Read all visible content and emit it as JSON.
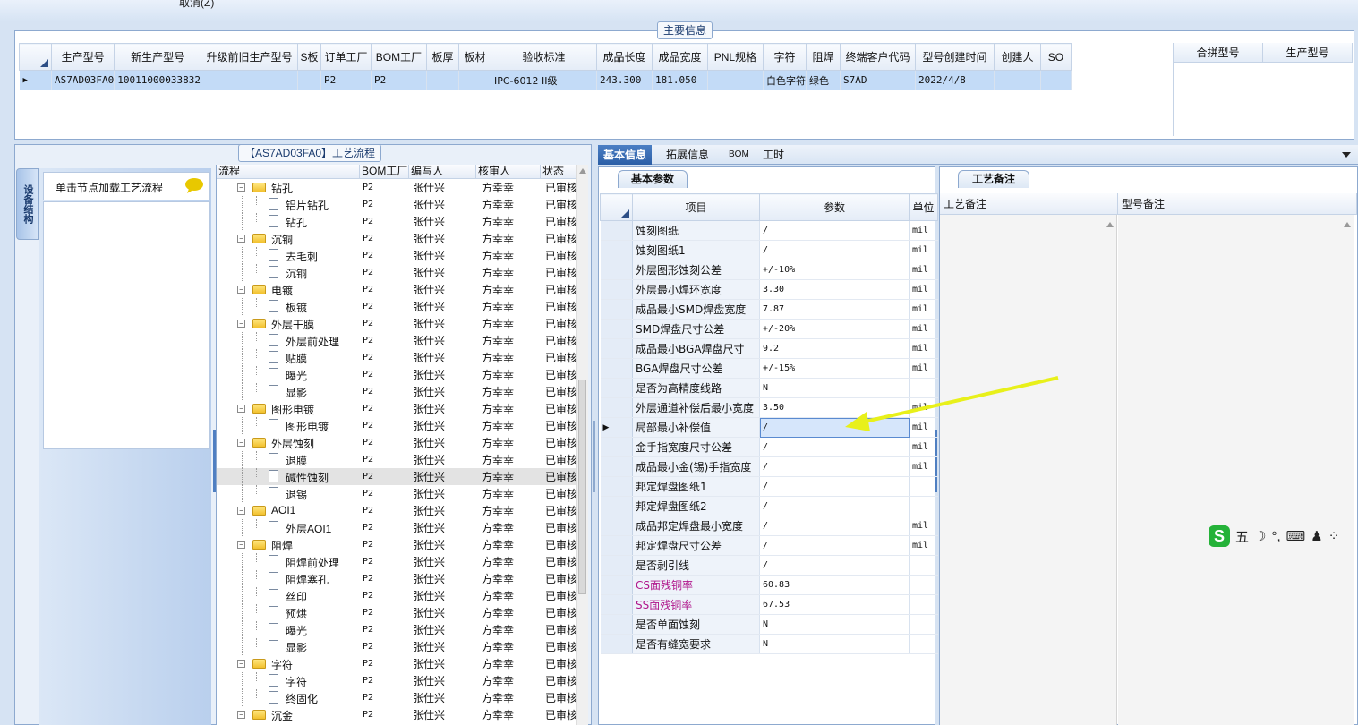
{
  "toolbar": {
    "cancel_label": "取消(Z)"
  },
  "main_info": {
    "title": "主要信息",
    "columns": [
      "生产型号",
      "新生产型号",
      "升级前旧生产型号",
      "S板",
      "订单工厂",
      "BOM工厂",
      "板厚",
      "板材",
      "验收标准",
      "成品长度",
      "成品宽度",
      "PNL规格",
      "字符",
      "阻焊",
      "终端客户代码",
      "型号创建时间",
      "创建人",
      "SO"
    ],
    "row": [
      "AS7AD03FA0",
      "10011000033832",
      "",
      "",
      "P2",
      "P2",
      "",
      "",
      "IPC-6012 II级",
      "243.300",
      "181.050",
      "",
      "白色字符",
      "绿色",
      "S7AD",
      "2022/4/8",
      "",
      ""
    ],
    "merge_columns": [
      "合拼型号",
      "生产型号"
    ]
  },
  "flow": {
    "title": "【AS7AD03FA0】工艺流程",
    "side_tab": "设备结构",
    "side_header": "单击节点加载工艺流程",
    "columns": [
      "流程",
      "BOM工厂",
      "编写人",
      "核审人",
      "状态"
    ],
    "rows": [
      {
        "name": "钻孔",
        "level": 0,
        "bom": "P2",
        "writer": "张仕兴",
        "reviewer": "方幸幸",
        "status": "已审核"
      },
      {
        "name": "铝片钻孔",
        "level": 1,
        "bom": "P2",
        "writer": "张仕兴",
        "reviewer": "方幸幸",
        "status": "已审核"
      },
      {
        "name": "钻孔",
        "level": 1,
        "bom": "P2",
        "writer": "张仕兴",
        "reviewer": "方幸幸",
        "status": "已审核"
      },
      {
        "name": "沉铜",
        "level": 0,
        "bom": "P2",
        "writer": "张仕兴",
        "reviewer": "方幸幸",
        "status": "已审核"
      },
      {
        "name": "去毛刺",
        "level": 1,
        "bom": "P2",
        "writer": "张仕兴",
        "reviewer": "方幸幸",
        "status": "已审核"
      },
      {
        "name": "沉铜",
        "level": 1,
        "bom": "P2",
        "writer": "张仕兴",
        "reviewer": "方幸幸",
        "status": "已审核"
      },
      {
        "name": "电镀",
        "level": 0,
        "bom": "P2",
        "writer": "张仕兴",
        "reviewer": "方幸幸",
        "status": "已审核"
      },
      {
        "name": "板镀",
        "level": 1,
        "bom": "P2",
        "writer": "张仕兴",
        "reviewer": "方幸幸",
        "status": "已审核"
      },
      {
        "name": "外层干膜",
        "level": 0,
        "bom": "P2",
        "writer": "张仕兴",
        "reviewer": "方幸幸",
        "status": "已审核"
      },
      {
        "name": "外层前处理",
        "level": 1,
        "bom": "P2",
        "writer": "张仕兴",
        "reviewer": "方幸幸",
        "status": "已审核"
      },
      {
        "name": "贴膜",
        "level": 1,
        "bom": "P2",
        "writer": "张仕兴",
        "reviewer": "方幸幸",
        "status": "已审核"
      },
      {
        "name": "曝光",
        "level": 1,
        "bom": "P2",
        "writer": "张仕兴",
        "reviewer": "方幸幸",
        "status": "已审核"
      },
      {
        "name": "显影",
        "level": 1,
        "bom": "P2",
        "writer": "张仕兴",
        "reviewer": "方幸幸",
        "status": "已审核"
      },
      {
        "name": "图形电镀",
        "level": 0,
        "bom": "P2",
        "writer": "张仕兴",
        "reviewer": "方幸幸",
        "status": "已审核"
      },
      {
        "name": "图形电镀",
        "level": 1,
        "bom": "P2",
        "writer": "张仕兴",
        "reviewer": "方幸幸",
        "status": "已审核"
      },
      {
        "name": "外层蚀刻",
        "level": 0,
        "bom": "P2",
        "writer": "张仕兴",
        "reviewer": "方幸幸",
        "status": "已审核"
      },
      {
        "name": "退膜",
        "level": 1,
        "bom": "P2",
        "writer": "张仕兴",
        "reviewer": "方幸幸",
        "status": "已审核"
      },
      {
        "name": "碱性蚀刻",
        "level": 1,
        "bom": "P2",
        "writer": "张仕兴",
        "reviewer": "方幸幸",
        "status": "已审核",
        "selected": true
      },
      {
        "name": "退锡",
        "level": 1,
        "bom": "P2",
        "writer": "张仕兴",
        "reviewer": "方幸幸",
        "status": "已审核"
      },
      {
        "name": "AOI1",
        "level": 0,
        "bom": "P2",
        "writer": "张仕兴",
        "reviewer": "方幸幸",
        "status": "已审核"
      },
      {
        "name": "外层AOI1",
        "level": 1,
        "bom": "P2",
        "writer": "张仕兴",
        "reviewer": "方幸幸",
        "status": "已审核"
      },
      {
        "name": "阻焊",
        "level": 0,
        "bom": "P2",
        "writer": "张仕兴",
        "reviewer": "方幸幸",
        "status": "已审核"
      },
      {
        "name": "阻焊前处理",
        "level": 1,
        "bom": "P2",
        "writer": "张仕兴",
        "reviewer": "方幸幸",
        "status": "已审核"
      },
      {
        "name": "阻焊塞孔",
        "level": 1,
        "bom": "P2",
        "writer": "张仕兴",
        "reviewer": "方幸幸",
        "status": "已审核"
      },
      {
        "name": "丝印",
        "level": 1,
        "bom": "P2",
        "writer": "张仕兴",
        "reviewer": "方幸幸",
        "status": "已审核"
      },
      {
        "name": "预烘",
        "level": 1,
        "bom": "P2",
        "writer": "张仕兴",
        "reviewer": "方幸幸",
        "status": "已审核"
      },
      {
        "name": "曝光",
        "level": 1,
        "bom": "P2",
        "writer": "张仕兴",
        "reviewer": "方幸幸",
        "status": "已审核"
      },
      {
        "name": "显影",
        "level": 1,
        "bom": "P2",
        "writer": "张仕兴",
        "reviewer": "方幸幸",
        "status": "已审核"
      },
      {
        "name": "字符",
        "level": 0,
        "bom": "P2",
        "writer": "张仕兴",
        "reviewer": "方幸幸",
        "status": "已审核"
      },
      {
        "name": "字符",
        "level": 1,
        "bom": "P2",
        "writer": "张仕兴",
        "reviewer": "方幸幸",
        "status": "已审核"
      },
      {
        "name": "终固化",
        "level": 1,
        "bom": "P2",
        "writer": "张仕兴",
        "reviewer": "方幸幸",
        "status": "已审核"
      },
      {
        "name": "沉金",
        "level": 0,
        "bom": "P2",
        "writer": "张仕兴",
        "reviewer": "方幸幸",
        "status": "已审核"
      }
    ]
  },
  "tabs": [
    "基本信息",
    "拓展信息",
    "BOM",
    "工时"
  ],
  "params": {
    "tab_label": "基本参数",
    "columns": [
      "项目",
      "参数",
      "单位"
    ],
    "rows": [
      {
        "item": "蚀刻图纸",
        "value": "/",
        "unit": "mil"
      },
      {
        "item": "蚀刻图纸1",
        "value": "/",
        "unit": "mil"
      },
      {
        "item": "外层图形蚀刻公差",
        "value": "+/-10%",
        "unit": "mil"
      },
      {
        "item": "外层最小焊环宽度",
        "value": "3.30",
        "unit": "mil"
      },
      {
        "item": "成品最小SMD焊盘宽度",
        "value": "7.87",
        "unit": "mil"
      },
      {
        "item": "SMD焊盘尺寸公差",
        "value": "+/-20%",
        "unit": "mil"
      },
      {
        "item": "成品最小BGA焊盘尺寸",
        "value": "9.2",
        "unit": "mil"
      },
      {
        "item": "BGA焊盘尺寸公差",
        "value": "+/-15%",
        "unit": "mil"
      },
      {
        "item": "是否为高精度线路",
        "value": "N",
        "unit": ""
      },
      {
        "item": "外层通道补偿后最小宽度",
        "value": "3.50",
        "unit": "mil"
      },
      {
        "item": "局部最小补偿值",
        "value": "/",
        "unit": "mil",
        "current": true
      },
      {
        "item": "金手指宽度尺寸公差",
        "value": "/",
        "unit": "mil"
      },
      {
        "item": "成品最小金(锡)手指宽度",
        "value": "/",
        "unit": "mil"
      },
      {
        "item": "邦定焊盘图纸1",
        "value": "/",
        "unit": ""
      },
      {
        "item": "邦定焊盘图纸2",
        "value": "/",
        "unit": ""
      },
      {
        "item": "成品邦定焊盘最小宽度",
        "value": "/",
        "unit": "mil"
      },
      {
        "item": "邦定焊盘尺寸公差",
        "value": "/",
        "unit": "mil"
      },
      {
        "item": "是否剥引线",
        "value": "/",
        "unit": ""
      },
      {
        "item": "CS面残铜率",
        "value": "60.83",
        "unit": "",
        "highlight": true
      },
      {
        "item": "SS面残铜率",
        "value": "67.53",
        "unit": "",
        "highlight": true
      },
      {
        "item": "是否单面蚀刻",
        "value": "N",
        "unit": ""
      },
      {
        "item": "是否有缝宽要求",
        "value": "N",
        "unit": ""
      }
    ]
  },
  "notes": {
    "tab_label": "工艺备注",
    "columns": [
      "工艺备注",
      "型号备注"
    ]
  },
  "ime": {
    "mode_char": "五"
  },
  "colors": {
    "accent": "#2b5ea6",
    "arrow": "#e8f01a",
    "magenta": "#b0168c"
  }
}
